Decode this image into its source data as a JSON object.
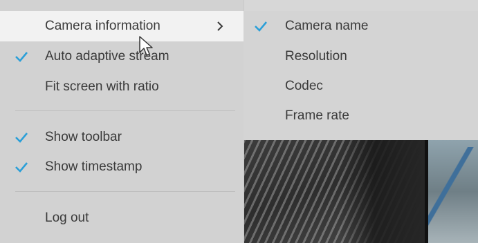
{
  "main_menu": {
    "items": [
      {
        "label": "Camera information",
        "checked": false,
        "has_submenu": true,
        "active": true
      },
      {
        "label": "Auto adaptive stream",
        "checked": true,
        "has_submenu": false,
        "active": false
      },
      {
        "label": "Fit screen with ratio",
        "checked": false,
        "has_submenu": false,
        "active": false
      },
      {
        "label": "Show toolbar",
        "checked": true,
        "has_submenu": false,
        "active": false
      },
      {
        "label": "Show timestamp",
        "checked": true,
        "has_submenu": false,
        "active": false
      },
      {
        "label": "Log out",
        "checked": false,
        "has_submenu": false,
        "active": false
      }
    ]
  },
  "sub_menu": {
    "items": [
      {
        "label": "Camera name",
        "checked": true
      },
      {
        "label": "Resolution",
        "checked": false
      },
      {
        "label": "Codec",
        "checked": false
      },
      {
        "label": "Frame rate",
        "checked": false
      }
    ]
  },
  "colors": {
    "check_accent": "#2a9fd8",
    "menu_background": "#d2d2d2",
    "active_item_background": "#f2f2f2",
    "text": "#3a3a3a"
  },
  "icons": {
    "check": "checkmark-icon",
    "submenu_arrow": "chevron-right-icon",
    "pointer": "mouse-cursor-icon"
  }
}
